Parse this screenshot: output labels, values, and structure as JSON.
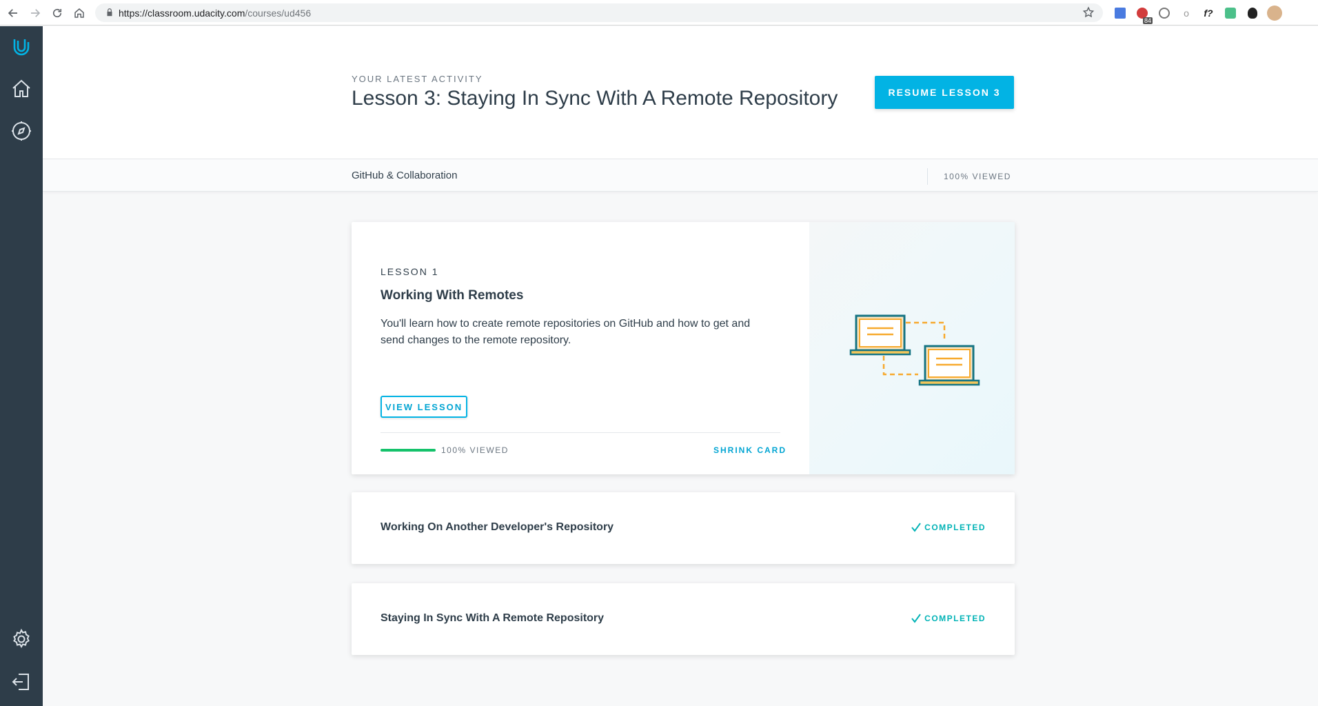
{
  "browser": {
    "url_host": "https://classroom.udacity.com",
    "url_path": "/courses/ud456",
    "extension_badge": "84"
  },
  "sidebar": {
    "items": [
      {
        "name": "udacity-logo"
      },
      {
        "name": "home"
      },
      {
        "name": "explore"
      },
      {
        "name": "settings"
      },
      {
        "name": "logout"
      }
    ]
  },
  "header": {
    "latest_label": "YOUR LATEST ACTIVITY",
    "latest_title": "Lesson 3: Staying In Sync With A Remote Repository",
    "resume_label": "RESUME LESSON 3"
  },
  "subbar": {
    "course_name": "GitHub & Collaboration",
    "viewed": "100% VIEWED"
  },
  "lesson_card": {
    "number_label": "LESSON 1",
    "title": "Working With Remotes",
    "description": "You'll learn how to create remote repositories on GitHub and how to get and send changes to the remote repository.",
    "view_label": "VIEW LESSON",
    "progress": 1.0,
    "progress_label": "100% VIEWED",
    "shrink_label": "SHRINK CARD"
  },
  "lessons": [
    {
      "title": "Working On Another Developer's Repository",
      "status": "COMPLETED"
    },
    {
      "title": "Staying In Sync With A Remote Repository",
      "status": "COMPLETED"
    }
  ],
  "colors": {
    "accent": "#02b3e4",
    "sidebar": "#2e3d49",
    "progress": "#15c26b",
    "completed": "#02b3b6"
  }
}
